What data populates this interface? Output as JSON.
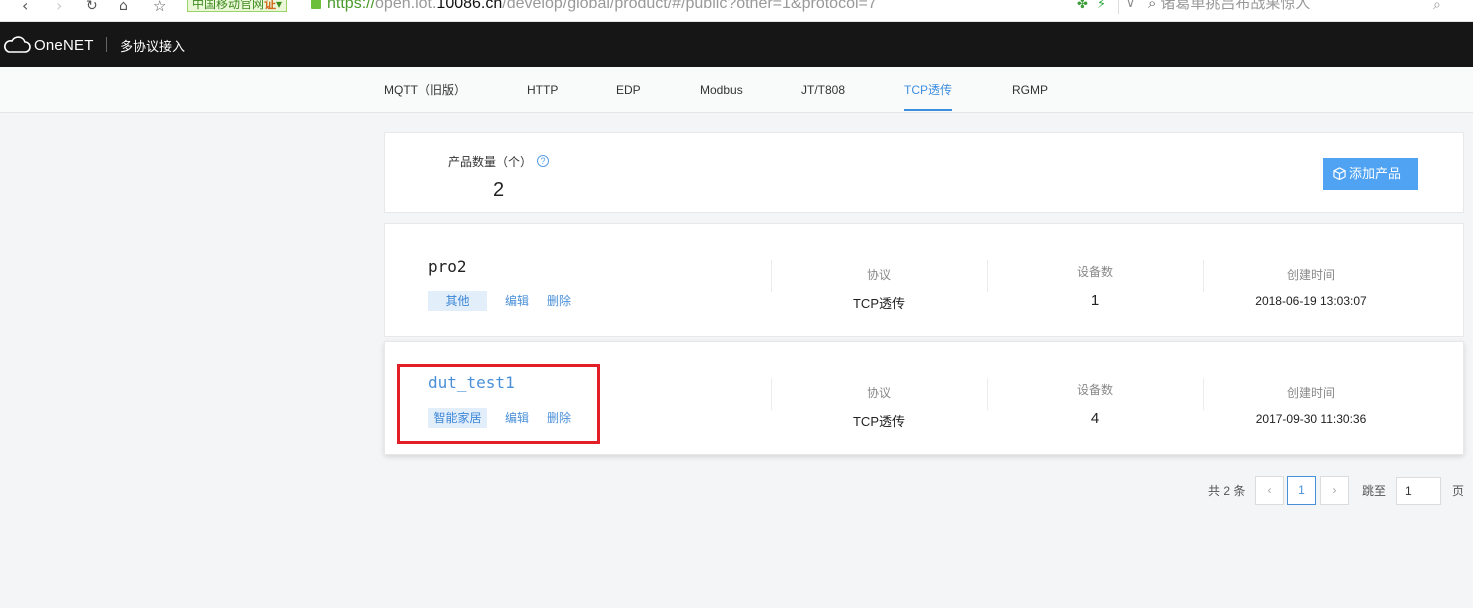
{
  "browser": {
    "site_badge": "中国移动官网",
    "site_badge_cert": "证",
    "url_scheme": "https://",
    "url_host_prefix": "open.iot.",
    "url_host_main": "10086.cn",
    "url_path": "/develop/global/product/#/public?other=1&protocol=7",
    "search_placeholder": "诸葛单挑吕布战果惊人"
  },
  "header": {
    "logo_text": "OneNET",
    "section_title": "多协议接入"
  },
  "tabs": [
    {
      "label": "MQTT（旧版）",
      "active": false
    },
    {
      "label": "HTTP",
      "active": false
    },
    {
      "label": "EDP",
      "active": false
    },
    {
      "label": "Modbus",
      "active": false
    },
    {
      "label": "JT/T808",
      "active": false
    },
    {
      "label": "TCP透传",
      "active": true
    },
    {
      "label": "RGMP",
      "active": false
    }
  ],
  "summary": {
    "count_label": "产品数量（个）",
    "count": "2",
    "add_button_label": "添加产品"
  },
  "products": [
    {
      "name": "pro2",
      "tag": "其他",
      "edit_label": "编辑",
      "delete_label": "删除",
      "protocol_label": "协议",
      "protocol": "TCP透传",
      "device_count_label": "设备数",
      "device_count": "1",
      "created_label": "创建时间",
      "created": "2018-06-19 13:03:07"
    },
    {
      "name": "dut_test1",
      "tag": "智能家居",
      "edit_label": "编辑",
      "delete_label": "删除",
      "protocol_label": "协议",
      "protocol": "TCP透传",
      "device_count_label": "设备数",
      "device_count": "4",
      "created_label": "创建时间",
      "created": "2017-09-30 11:30:36"
    }
  ],
  "pagination": {
    "total_text": "共 2 条",
    "prev_icon": "‹",
    "current_page": "1",
    "next_icon": "›",
    "jump_label": "跳至",
    "jump_value": "1",
    "page_suffix": "页"
  },
  "colors": {
    "accent": "#3e8fde",
    "add_button": "#4fa3f2",
    "top_bar": "#161616",
    "highlight": "#e21f26"
  }
}
